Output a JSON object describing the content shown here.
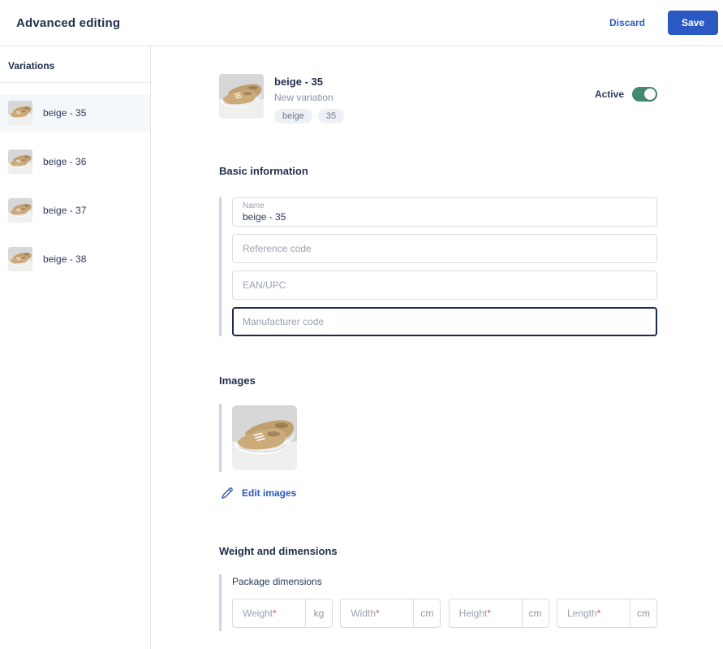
{
  "header": {
    "title": "Advanced editing",
    "discard_label": "Discard",
    "save_label": "Save"
  },
  "sidebar": {
    "title": "Variations",
    "items": [
      {
        "label": "beige - 35",
        "selected": true
      },
      {
        "label": "beige - 36",
        "selected": false
      },
      {
        "label": "beige - 37",
        "selected": false
      },
      {
        "label": "beige - 38",
        "selected": false
      }
    ]
  },
  "product_header": {
    "name": "beige - 35",
    "status": "New variation",
    "badges": [
      "beige",
      "35"
    ],
    "active_label": "Active",
    "active": true
  },
  "basic_information": {
    "heading": "Basic information",
    "name_field": {
      "label": "Name",
      "value": "beige - 35"
    },
    "reference_field": {
      "placeholder": "Reference code"
    },
    "ean_field": {
      "placeholder": "EAN/UPC"
    },
    "manufacturer_field": {
      "placeholder": "Manufacturer code",
      "focused": true
    }
  },
  "images": {
    "heading": "Images",
    "edit_label": "Edit images"
  },
  "weight_dimensions": {
    "heading": "Weight and dimensions",
    "group_label": "Package dimensions",
    "required_mark": "*",
    "fields": [
      {
        "label": "Weight",
        "unit": "kg"
      },
      {
        "label": "Width",
        "unit": "cm"
      },
      {
        "label": "Height",
        "unit": "cm"
      },
      {
        "label": "Length",
        "unit": "cm"
      }
    ]
  },
  "colors": {
    "accent_blue": "#2b59c3",
    "dark_navy": "#22304e",
    "toggle_green": "#418a71",
    "accent_bar": "#ccd6e8",
    "required_red": "#d9534f"
  }
}
